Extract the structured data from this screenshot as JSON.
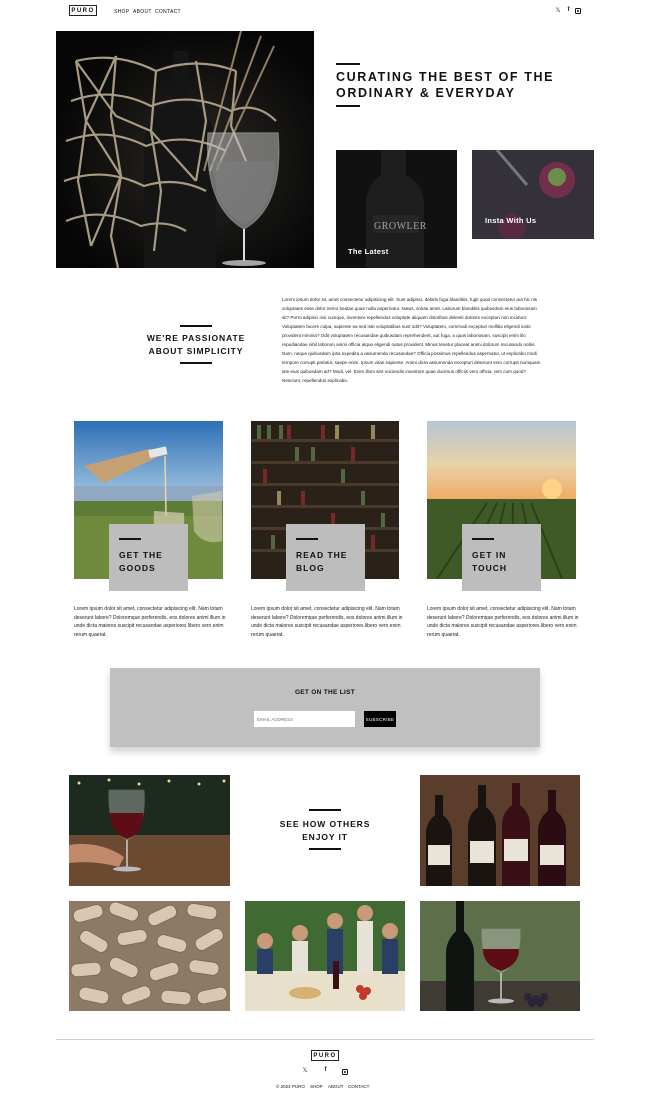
{
  "nav": {
    "logo": "PURO",
    "links": [
      "SHOP",
      "ABOUT",
      "CONTACT"
    ],
    "social": [
      "x-icon",
      "facebook-icon",
      "instagram-icon"
    ]
  },
  "hero": {
    "title_line1": "CURATING THE BEST OF THE",
    "title_line2": "ORDINARY & EVERYDAY",
    "tiles": [
      {
        "caption": "The Latest",
        "bottle_label": "GROWLER"
      },
      {
        "caption": "Insta With Us"
      }
    ]
  },
  "about": {
    "title_line1": "WE'RE PASSIONATE",
    "title_line2": "ABOUT SIMPLICITY",
    "body": "Lorem ipsum dolor sit, amet consectetur adipisicing elit. Sunt adipisci, debitis fuga blanditiis, fugit quod consectetur aut hic nis voluptates esse dolor nemo beatae quae nulla aspernatur. Natus, soluta amet. Laborum blanditiis quibusdam eius laboriosam sit? Porro adipisci nisi cumque, inventore repellendus voluptate aliquam doloribus deleniti dolores excepturi non incidunt. Voluptatem facere culpa, sapiente ea sed iste voluptatibus sunt odit? Voluptatem, commodi excepturi mollitia eligendi iusto provident minima? Odit voluptatem recusandae quibusdam reprehenderit, aut fuga, a quas laboriosam, suscipit enim illo repudiandae nihil laborum animi officia atque eligendi natus provident. Minus tenetur placeat animi dolorum recusando nobis. Nam, neque quibusdam ipsa expedita a assumenda recusandae? Officia possimus repellendus aspernatur, ut explicabo modi tempore corrupti pariatur, saepe enim. Ipsum vitae sapiente. Animi dicta assumenda excepturi deserunt vero corrupti numquam iste eius quibusdam ad? Modi, vel. Enim illum sint reiciendis inventore quae ducimus officiis vero officia, rem cum quod? Nesciunt, repellendus explicabo."
  },
  "cards": [
    {
      "line1": "GET THE",
      "line2": "GOODS",
      "text": "Lorem ipsum dolor sit amet, consectetur adipisicing elit. Nam totam deserunt labore? Doloremque perferendis, eos dolores animi illum in unde dicta maiores suscipit recusandae asperiores libero vero enim rerum quaerat."
    },
    {
      "line1": "READ THE",
      "line2": "BLOG",
      "text": "Lorem ipsum dolor sit amet, consectetur adipisicing elit. Nam totam deserunt labore? Doloremque perferendis, eos dolores animi illum in unde dicta maiores suscipit recusandae asperiores libero vero enim rerum quaerat."
    },
    {
      "line1": "GET IN",
      "line2": "TOUCH",
      "text": "Lorem ipsum dolor sit amet, consectetur adipisicing elit. Nam totam deserunt labore? Doloremque perferendis, eos dolores animi illum in unde dicta maiores suscipit recusandae asperiores libero vero enim rerum quaerat."
    }
  ],
  "newsletter": {
    "title": "GET ON THE LIST",
    "placeholder": "EMAIL ADDRESS",
    "button": "SUBSCRIBE"
  },
  "gallery": {
    "title_line1": "SEE HOW OTHERS",
    "title_line2": "ENJOY IT"
  },
  "footer": {
    "logo": "PURO",
    "copyright": "© 2024 PURO",
    "links": [
      "SHOP",
      "ABOUT",
      "CONTACT"
    ]
  }
}
